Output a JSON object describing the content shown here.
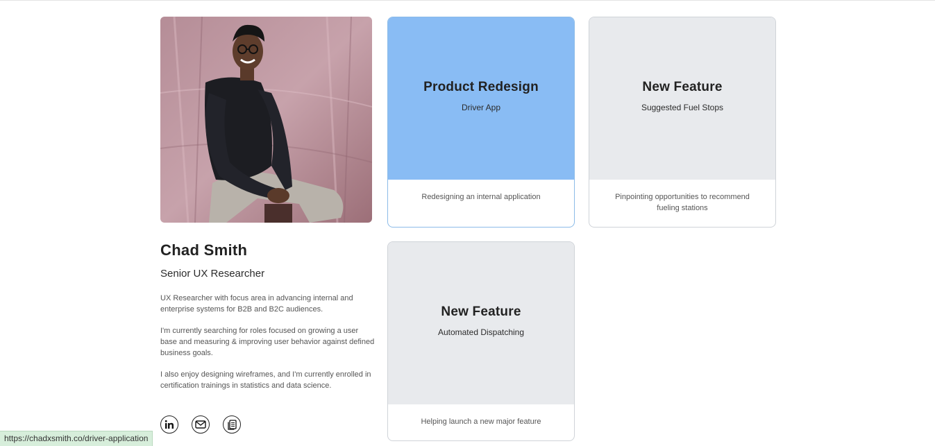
{
  "profile": {
    "name": "Chad Smith",
    "title": "Senior UX Researcher",
    "bio": [
      "UX Researcher with focus area in advancing internal and enterprise systems for B2B and B2C audiences.",
      "I'm currently searching for roles focused on growing a user base and measuring & improving user behavior against defined business goals.",
      "I also enjoy designing wireframes, and I'm currently enrolled in certification trainings in statistics and data science."
    ],
    "social": [
      "linkedin-icon",
      "mail-icon",
      "resume-icon"
    ]
  },
  "projects": [
    {
      "heading": "Product Redesign",
      "subheading": "Driver App",
      "description": "Redesigning an internal application",
      "highlight": "#89bcf4"
    },
    {
      "heading": "New Feature",
      "subheading": "Suggested Fuel Stops",
      "description": "Pinpointing opportunities to recommend fueling stations"
    },
    {
      "heading": "New Feature",
      "subheading": "Automated Dispatching",
      "description": "Helping launch a new major feature"
    }
  ],
  "status_bar": {
    "url": "https://chadxsmith.co/driver-application"
  },
  "colors": {
    "card_highlight": "#89bcf4",
    "card_default": "#e8eaed",
    "status_bg": "#d7eedb"
  }
}
